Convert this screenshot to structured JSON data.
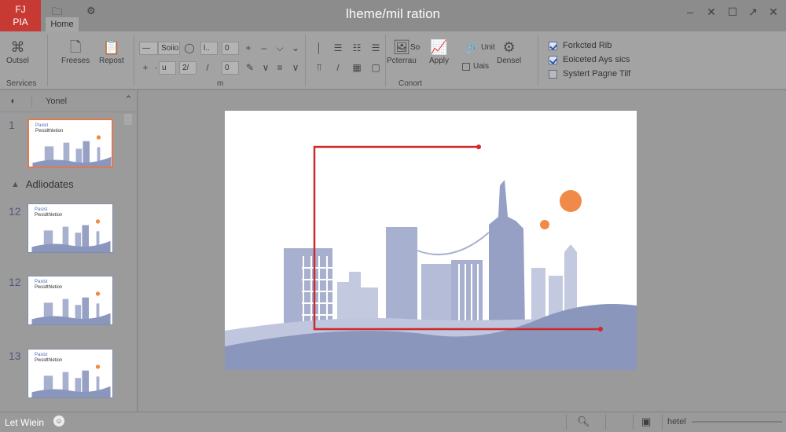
{
  "window": {
    "title": "lheme/mil ration",
    "app_button": {
      "line1": "FJ",
      "line2": "PIA"
    }
  },
  "tabs": {
    "home": "Home"
  },
  "ribbon": {
    "groups": {
      "services": "Services",
      "middle": "m",
      "content": "Conort"
    },
    "buttons": {
      "outsel": "Outsel",
      "freeses": "Freeses",
      "repost": "Repost",
      "pcterrau": "Pcterrau",
      "apply": "Apply",
      "unit": "Unit",
      "uais": "Uais",
      "densel": "Densel"
    },
    "fields": {
      "font_name": "Soiio",
      "size1": "l..",
      "size2": "0",
      "size3": "u",
      "size4": "0",
      "style": "2/",
      "align": "So"
    },
    "options": [
      {
        "label": "Forkcted Rib",
        "checked": true
      },
      {
        "label": "Eoiceted Ays sics",
        "checked": true
      },
      {
        "label": "Systert Pagne Tilf",
        "checked": false
      }
    ]
  },
  "panel": {
    "header": "Yonel",
    "section": "Adliodates",
    "slides": [
      {
        "num": "1",
        "title": "Paxist",
        "subtitle": "Pwsidthletion",
        "selected": true
      },
      {
        "num": "12",
        "title": "Pasist",
        "subtitle": "Pwsidthletion",
        "selected": false
      },
      {
        "num": "12",
        "title": "Paxist",
        "subtitle": "Pwsidthletion",
        "selected": false
      },
      {
        "num": "13",
        "title": "Paxist",
        "subtitle": "Pwsidthletion",
        "selected": false
      }
    ]
  },
  "status": {
    "left": "Let Wiein",
    "notes": "hetel"
  },
  "colors": {
    "accent": "#c63a33",
    "selection": "#e07a4e",
    "building": "#a7b0cf",
    "building_dark": "#95a0c4",
    "hill": "#8b96bd",
    "sun": "#f08a48",
    "guide": "#cc2b2b"
  }
}
